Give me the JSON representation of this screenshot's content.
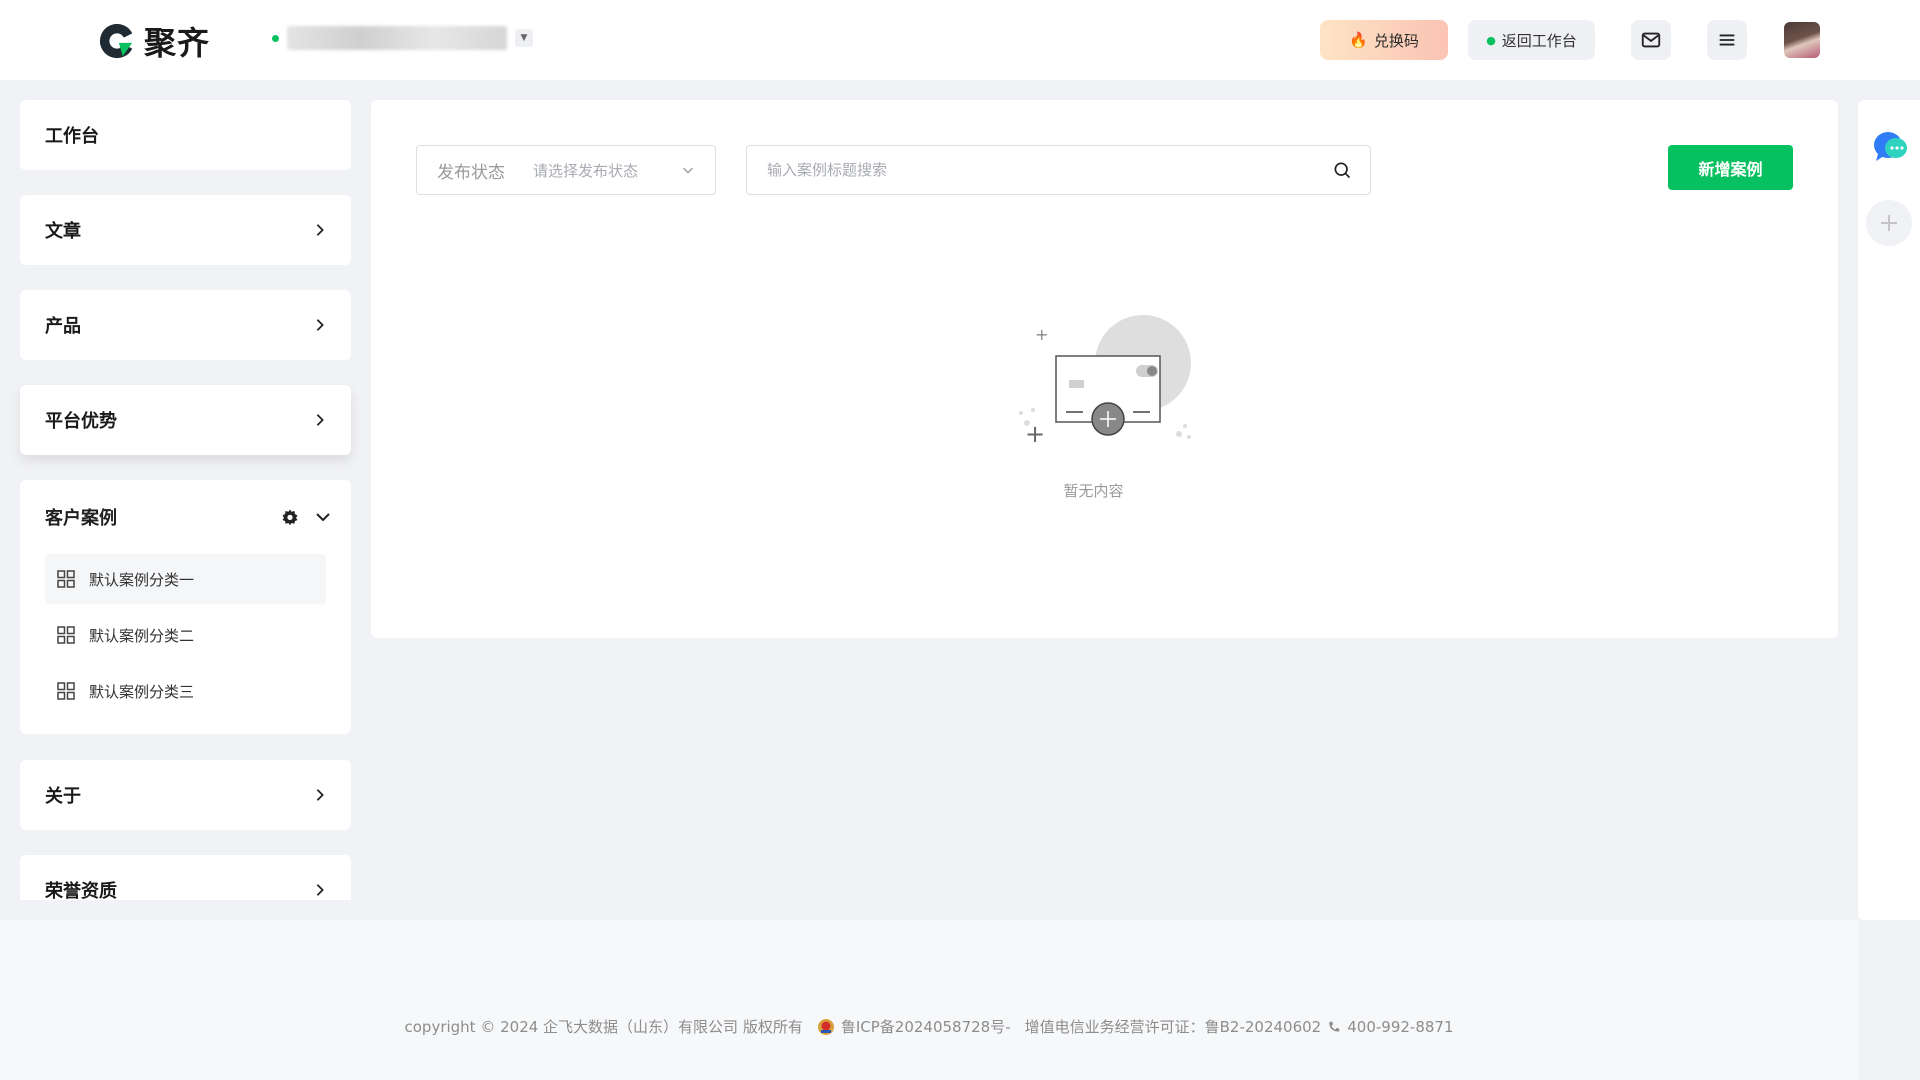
{
  "header": {
    "brand": "聚齐",
    "org_name_blurred": true,
    "redeem_label": "兑换码",
    "back_label": "返回工作台"
  },
  "sidebar": {
    "items": [
      {
        "label": "工作台"
      },
      {
        "label": "文章"
      },
      {
        "label": "产品"
      },
      {
        "label": "平台优势"
      }
    ],
    "group": {
      "label": "客户案例",
      "children": [
        {
          "label": "默认案例分类一"
        },
        {
          "label": "默认案例分类二"
        },
        {
          "label": "默认案例分类三"
        }
      ]
    },
    "items_after": [
      {
        "label": "关于"
      },
      {
        "label": "荣誉资质"
      }
    ]
  },
  "toolbar": {
    "status_label": "发布状态",
    "status_placeholder": "请选择发布状态",
    "search_placeholder": "输入案例标题搜索",
    "add_label": "新增案例"
  },
  "empty_state": {
    "text": "暂无内容"
  },
  "footer": {
    "copyright": "copyright © 2024 企飞大数据（山东）有限公司 版权所有",
    "icp": "鲁ICP备2024058728号-",
    "license": "增值电信业务经营许可证：鲁B2-20240602",
    "phone": "400-992-8871"
  },
  "colors": {
    "primary": "#07c160",
    "background": "#f1f2f5",
    "redeem_gradient_start": "#fde4c4",
    "redeem_gradient_end": "#fbc3b4"
  }
}
